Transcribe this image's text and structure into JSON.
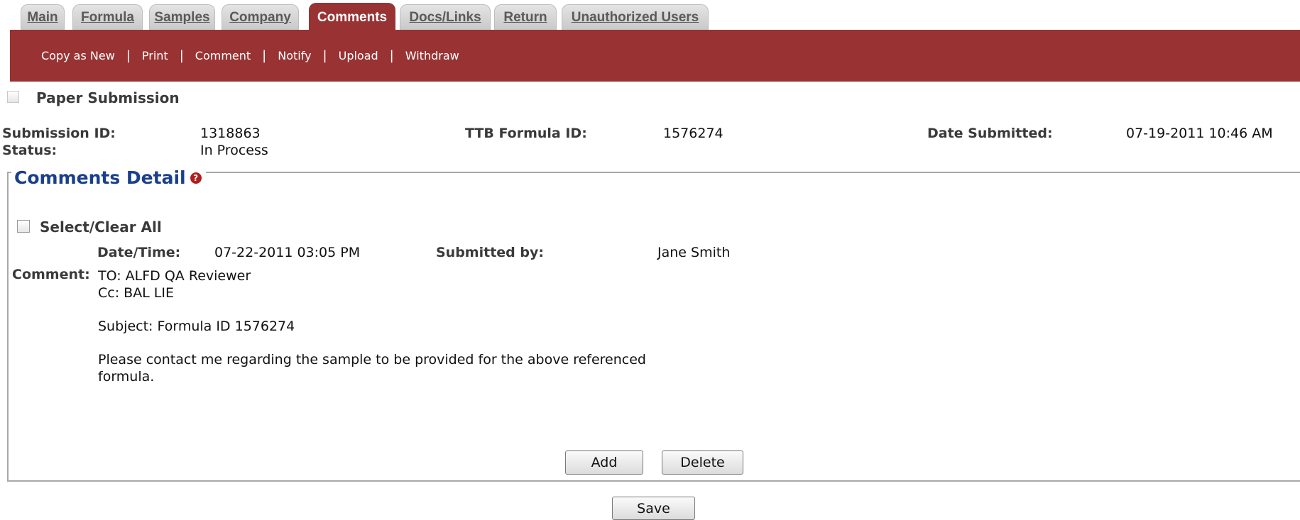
{
  "tabs": [
    {
      "label": "Main",
      "active": false
    },
    {
      "label": "Formula",
      "active": false
    },
    {
      "label": "Samples",
      "active": false
    },
    {
      "label": "Company",
      "active": false
    },
    {
      "label": "Comments",
      "active": true
    },
    {
      "label": "Docs/Links",
      "active": false
    },
    {
      "label": "Return",
      "active": false
    },
    {
      "label": "Unauthorized Users",
      "active": false
    }
  ],
  "actions": [
    "Copy as New",
    "Print",
    "Comment",
    "Notify",
    "Upload",
    "Withdraw"
  ],
  "paper_submission": {
    "label": "Paper Submission",
    "checked": false
  },
  "info": {
    "submission_id_label": "Submission ID:",
    "submission_id": "1318863",
    "status_label": "Status:",
    "status": "In Process",
    "ttb_formula_id_label": "TTB Formula ID:",
    "ttb_formula_id": "1576274",
    "date_submitted_label": "Date Submitted:",
    "date_submitted": "07-19-2011 10:46 AM"
  },
  "comments_detail": {
    "title": "Comments Detail",
    "help_icon": "question-circle-icon",
    "select_clear_label": "Select/Clear All",
    "date_time_label": "Date/Time:",
    "date_time": "07-22-2011 03:05 PM",
    "submitted_by_label": "Submitted by:",
    "submitted_by": "Jane Smith",
    "comment_label": "Comment:",
    "comment_lines": [
      "TO: ALFD QA Reviewer",
      "Cc: BAL LIE",
      "Subject: Formula ID 1576274",
      "Please contact me regarding the sample to be provided for the above referenced",
      "formula."
    ],
    "add_label": "Add",
    "delete_label": "Delete"
  },
  "save_label": "Save",
  "colors": {
    "accent": "#993333",
    "legend": "#1a3f8c",
    "tab_inactive": "#d6d6d6"
  }
}
